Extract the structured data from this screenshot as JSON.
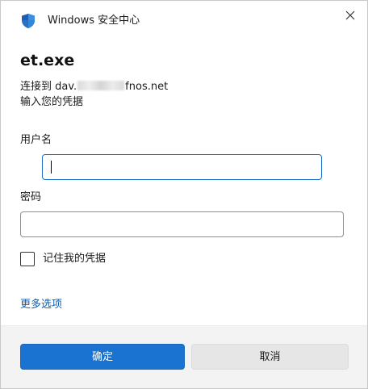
{
  "titlebar": {
    "title": "Windows 安全中心",
    "icon": "shield-icon",
    "close_icon": "close-icon"
  },
  "dialog": {
    "app_name": "et.exe",
    "connect_prefix": "连接到 dav.",
    "connect_suffix": "fnos.net",
    "instruction": "输入您的凭据"
  },
  "form": {
    "username_label": "用户名",
    "username_value": "",
    "password_label": "密码",
    "password_value": "",
    "remember_label": "记住我的凭据",
    "remember_checked": false,
    "more_options": "更多选项"
  },
  "buttons": {
    "ok": "确定",
    "cancel": "取消"
  },
  "colors": {
    "accent": "#1a73d0",
    "link": "#0b5cad",
    "shield": "#1b5fb4"
  }
}
